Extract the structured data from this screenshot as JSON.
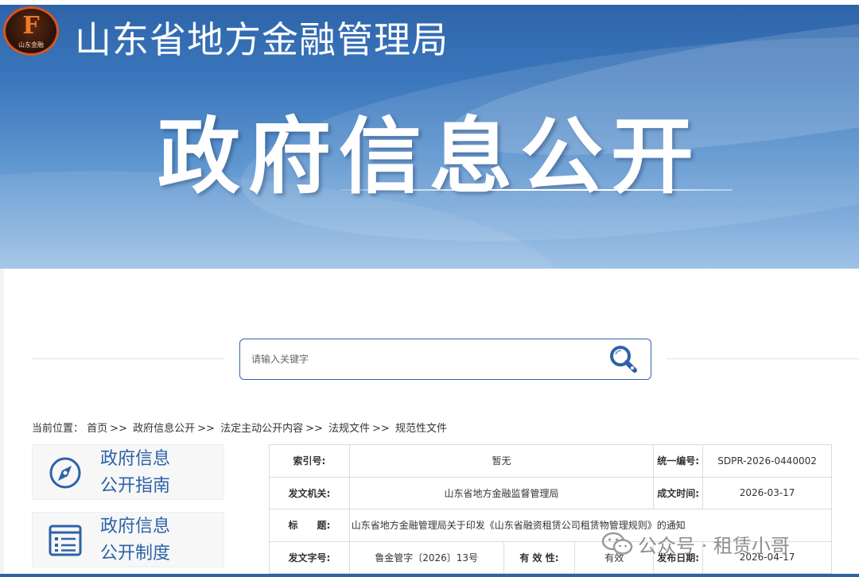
{
  "header": {
    "logo_text": "山东金融",
    "logo_letter": "F",
    "agency_name": "山东省地方金融管理局",
    "banner_title": "政府信息公开"
  },
  "search": {
    "placeholder": "请输入关键字"
  },
  "breadcrumb": {
    "prefix": "当前位置：",
    "items": [
      "首页",
      "政府信息公开",
      "法定主动公开内容",
      "法规文件",
      "规范性文件"
    ],
    "separator": ">>"
  },
  "sidebar": {
    "items": [
      {
        "line1": "政府信息",
        "line2": "公开指南",
        "icon": "compass-icon"
      },
      {
        "line1": "政府信息",
        "line2": "公开制度",
        "icon": "document-list-icon"
      }
    ]
  },
  "info": {
    "index_label": "索引号:",
    "index_value": "暂无",
    "uid_label": "统一编号:",
    "uid_value": "SDPR-2026-0440002",
    "issuer_label": "发文机关:",
    "issuer_value": "山东省地方金融监督管理局",
    "created_label": "成文时间:",
    "created_value": "2026-03-17",
    "title_label": "标　　题:",
    "title_value": "山东省地方金融管理局关于印发《山东省融资租赁公司租赁物管理规则》的通知",
    "doc_no_label": "发文字号:",
    "doc_no_value": "鲁金管字〔2026〕13号",
    "validity_label": "有 效 性:",
    "validity_value": "有效",
    "published_label": "发布日期:",
    "published_value": "2026-04-17"
  },
  "watermark": {
    "text": "公众号 · 租赁小哥",
    "icon": "wechat-icon"
  },
  "colors": {
    "brand_blue": "#2c62a9",
    "banner_top": "#2d63a8",
    "banner_bottom": "#9fc2e6",
    "logo_orange": "#d8561f"
  }
}
